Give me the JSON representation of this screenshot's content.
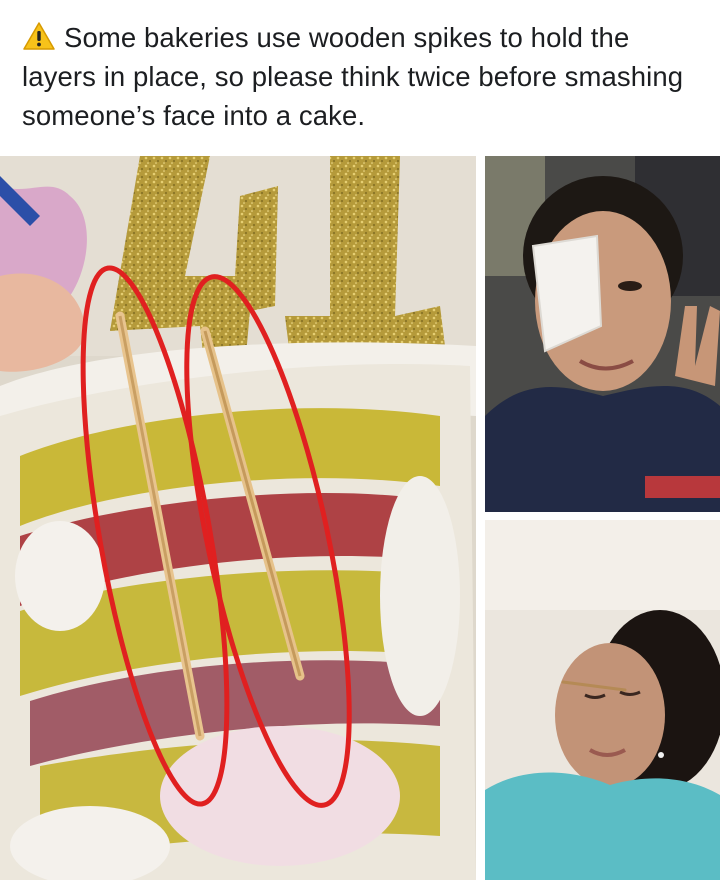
{
  "post": {
    "caption_icon": "warning-icon",
    "caption_text": "Some bakeries use wooden spikes to hold the layers in place, so please think twice before smashing someone’s face into a cake.",
    "accent_color": "#e02020",
    "images": [
      {
        "name": "cake-photo",
        "highlight": "red-ellipses-around-wooden-spikes"
      },
      {
        "name": "eye-patch-photo"
      },
      {
        "name": "temple-spike-photo"
      }
    ]
  }
}
